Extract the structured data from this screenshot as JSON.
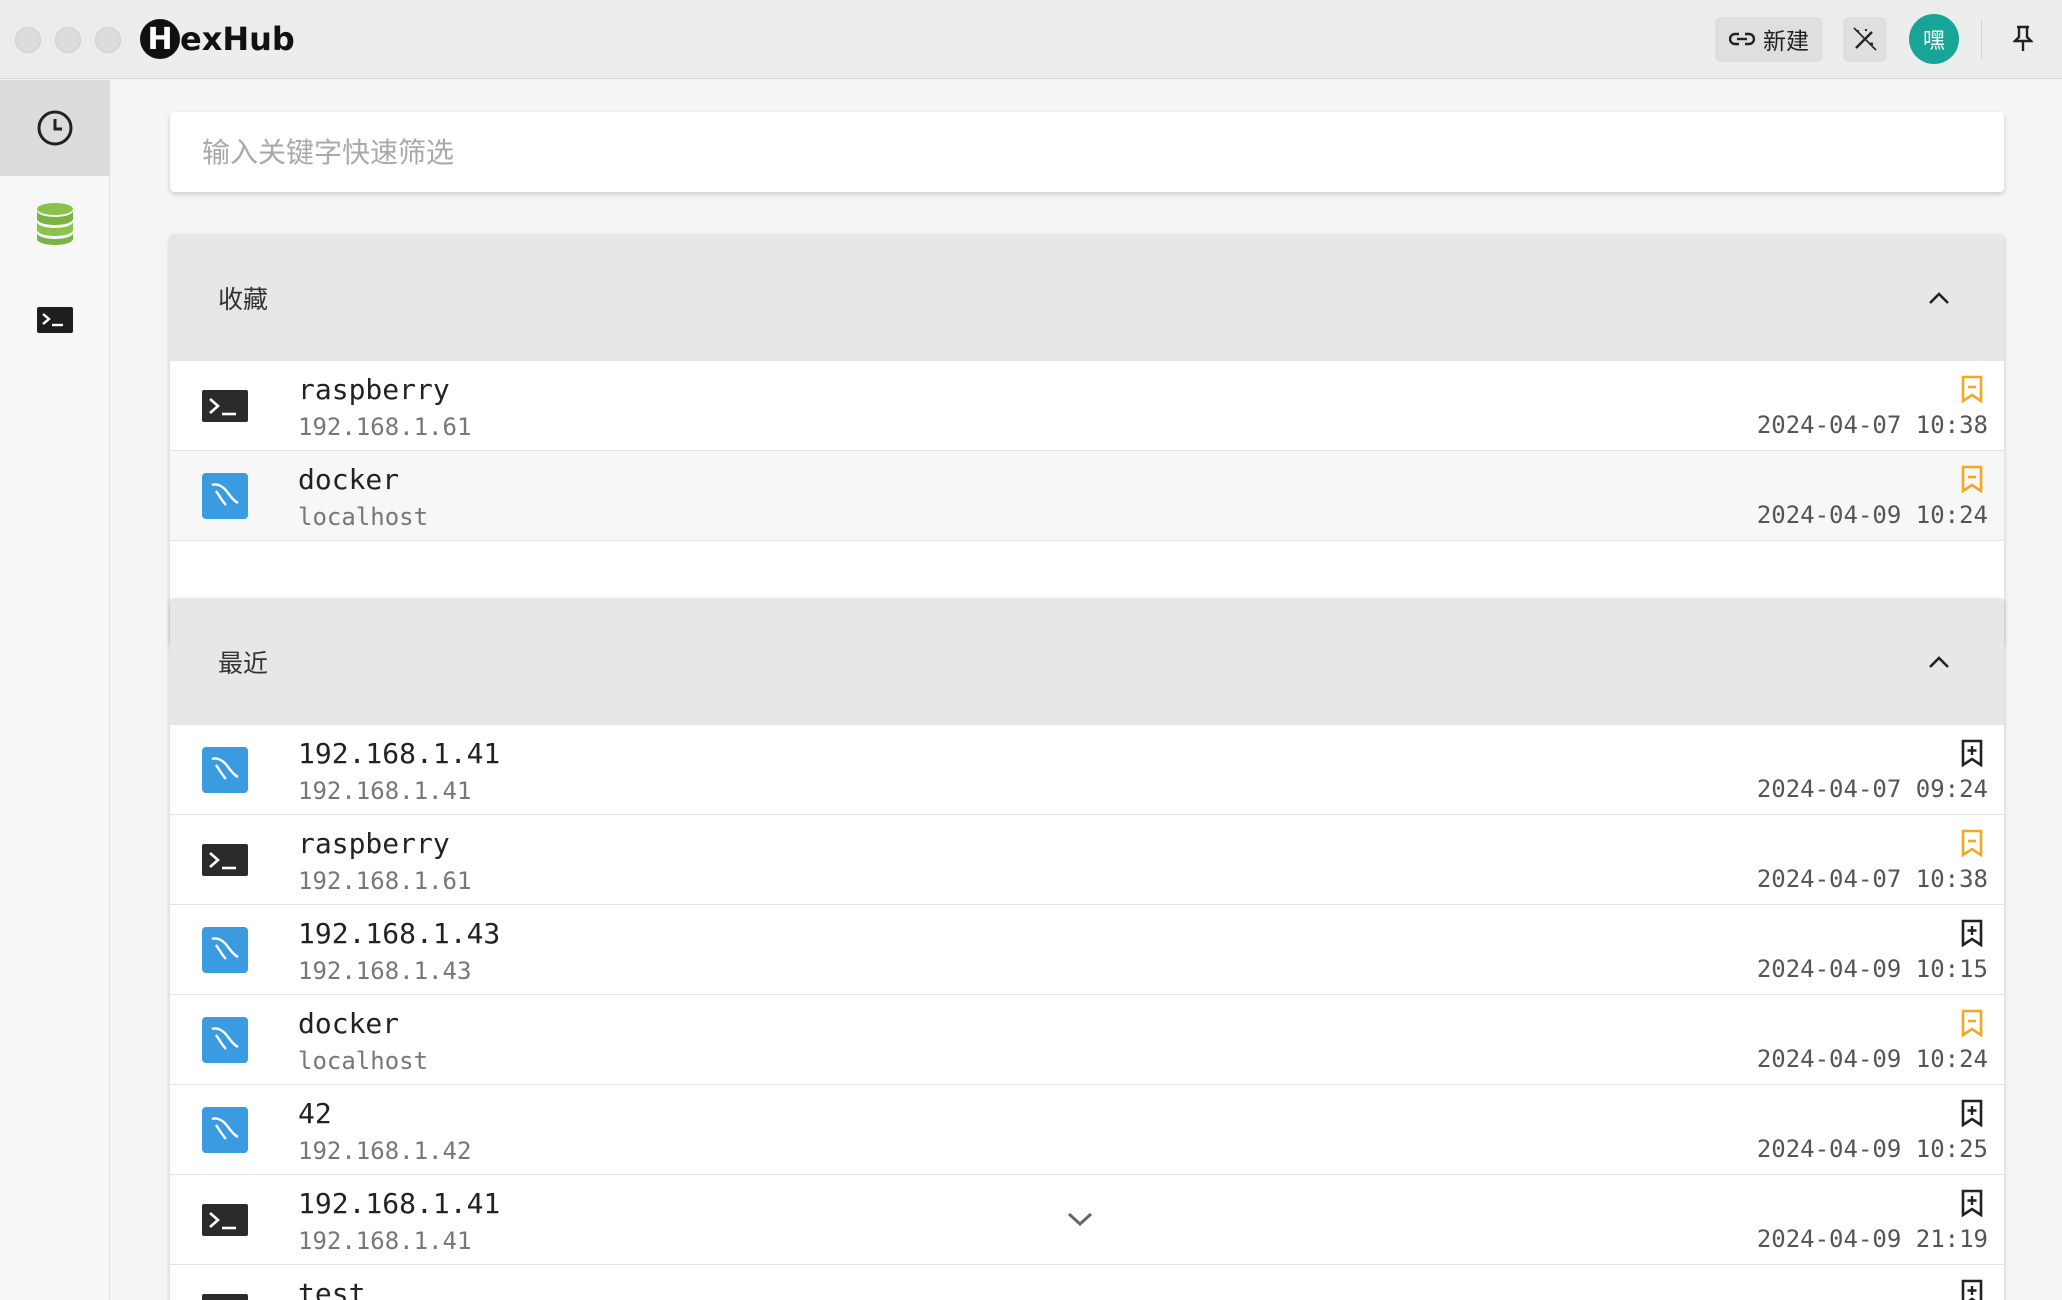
{
  "app": {
    "logo_letter": "H",
    "logo_text": "exHub"
  },
  "toolbar": {
    "new_label": "新建",
    "avatar_label": "嘿"
  },
  "search": {
    "placeholder": "输入关键字快速筛选",
    "value": ""
  },
  "sidebar": {
    "items": [
      {
        "name": "history",
        "icon": "clock-icon",
        "active": true
      },
      {
        "name": "database",
        "icon": "database-icon",
        "active": false
      },
      {
        "name": "terminal",
        "icon": "terminal-icon",
        "active": false
      }
    ]
  },
  "favorites": {
    "title": "收藏",
    "items": [
      {
        "name": "raspberry",
        "host": "192.168.1.61",
        "time": "2024-04-07 10:38",
        "type": "terminal",
        "bookmarked": true
      },
      {
        "name": "docker",
        "host": "localhost",
        "time": "2024-04-09 10:24",
        "type": "mysql",
        "bookmarked": true
      }
    ]
  },
  "recent": {
    "title": "最近",
    "items": [
      {
        "name": "192.168.1.41",
        "host": "192.168.1.41",
        "time": "2024-04-07 09:24",
        "type": "mysql",
        "bookmarked": false
      },
      {
        "name": "raspberry",
        "host": "192.168.1.61",
        "time": "2024-04-07 10:38",
        "type": "terminal",
        "bookmarked": true
      },
      {
        "name": "192.168.1.43",
        "host": "192.168.1.43",
        "time": "2024-04-09 10:15",
        "type": "mysql",
        "bookmarked": false
      },
      {
        "name": "docker",
        "host": "localhost",
        "time": "2024-04-09 10:24",
        "type": "mysql",
        "bookmarked": true
      },
      {
        "name": "42",
        "host": "192.168.1.42",
        "time": "2024-04-09 10:25",
        "type": "mysql",
        "bookmarked": false
      },
      {
        "name": "192.168.1.41",
        "host": "192.168.1.41",
        "time": "2024-04-09 21:19",
        "type": "terminal",
        "bookmarked": false
      },
      {
        "name": "test",
        "host": "",
        "time": "",
        "type": "terminal",
        "bookmarked": false
      }
    ]
  },
  "colors": {
    "accent_teal": "#16a596",
    "bookmark_orange": "#f5a623",
    "mysql_blue": "#3a9be0"
  }
}
